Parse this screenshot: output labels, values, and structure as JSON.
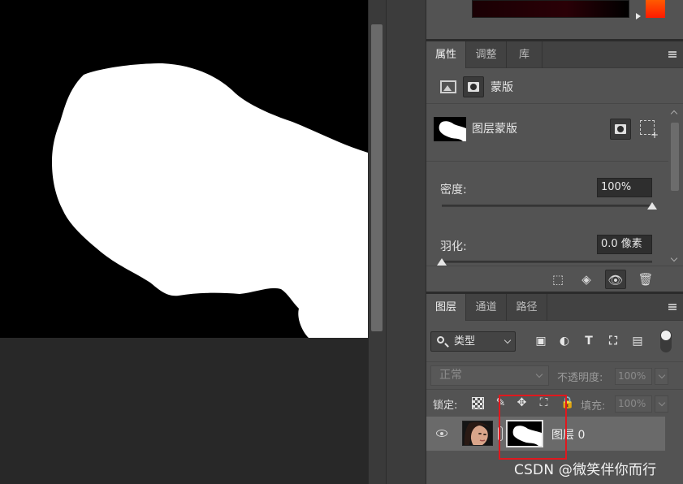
{
  "colors": {
    "canvas_bg": "#000000",
    "mask_white": "#ffffff",
    "panel_bg": "#535353",
    "accent_red_box": "#e0181e"
  },
  "properties_panel": {
    "tabs": [
      {
        "label": "属性",
        "active": true
      },
      {
        "label": "调整",
        "active": false
      },
      {
        "label": "库",
        "active": false
      }
    ],
    "mask_section_label": "蒙版",
    "layer_mask_label": "图层蒙版",
    "density_label": "密度:",
    "density_value": "100%",
    "density_fraction": 1.0,
    "feather_label": "羽化:",
    "feather_value": "0.0 像素",
    "feather_fraction": 0.0,
    "bottom_icons": [
      "selection-icon",
      "apply-mask-icon",
      "visibility-icon",
      "trash-icon"
    ]
  },
  "layers_panel": {
    "tabs": [
      {
        "label": "图层",
        "active": true
      },
      {
        "label": "通道",
        "active": false
      },
      {
        "label": "路径",
        "active": false
      }
    ],
    "filter_label": "类型",
    "filter_icons": [
      "image-filter-icon",
      "adjustment-filter-icon",
      "type-filter-icon",
      "shape-filter-icon",
      "smart-object-filter-icon"
    ],
    "blend_mode": "正常",
    "opacity_label": "不透明度:",
    "opacity_value": "100%",
    "lock_label": "锁定:",
    "fill_label": "填充:",
    "fill_value": "100%",
    "layers": [
      {
        "name": "图层 0",
        "visible": true,
        "has_mask": true
      }
    ]
  },
  "watermark": "CSDN @微笑伴你而行"
}
